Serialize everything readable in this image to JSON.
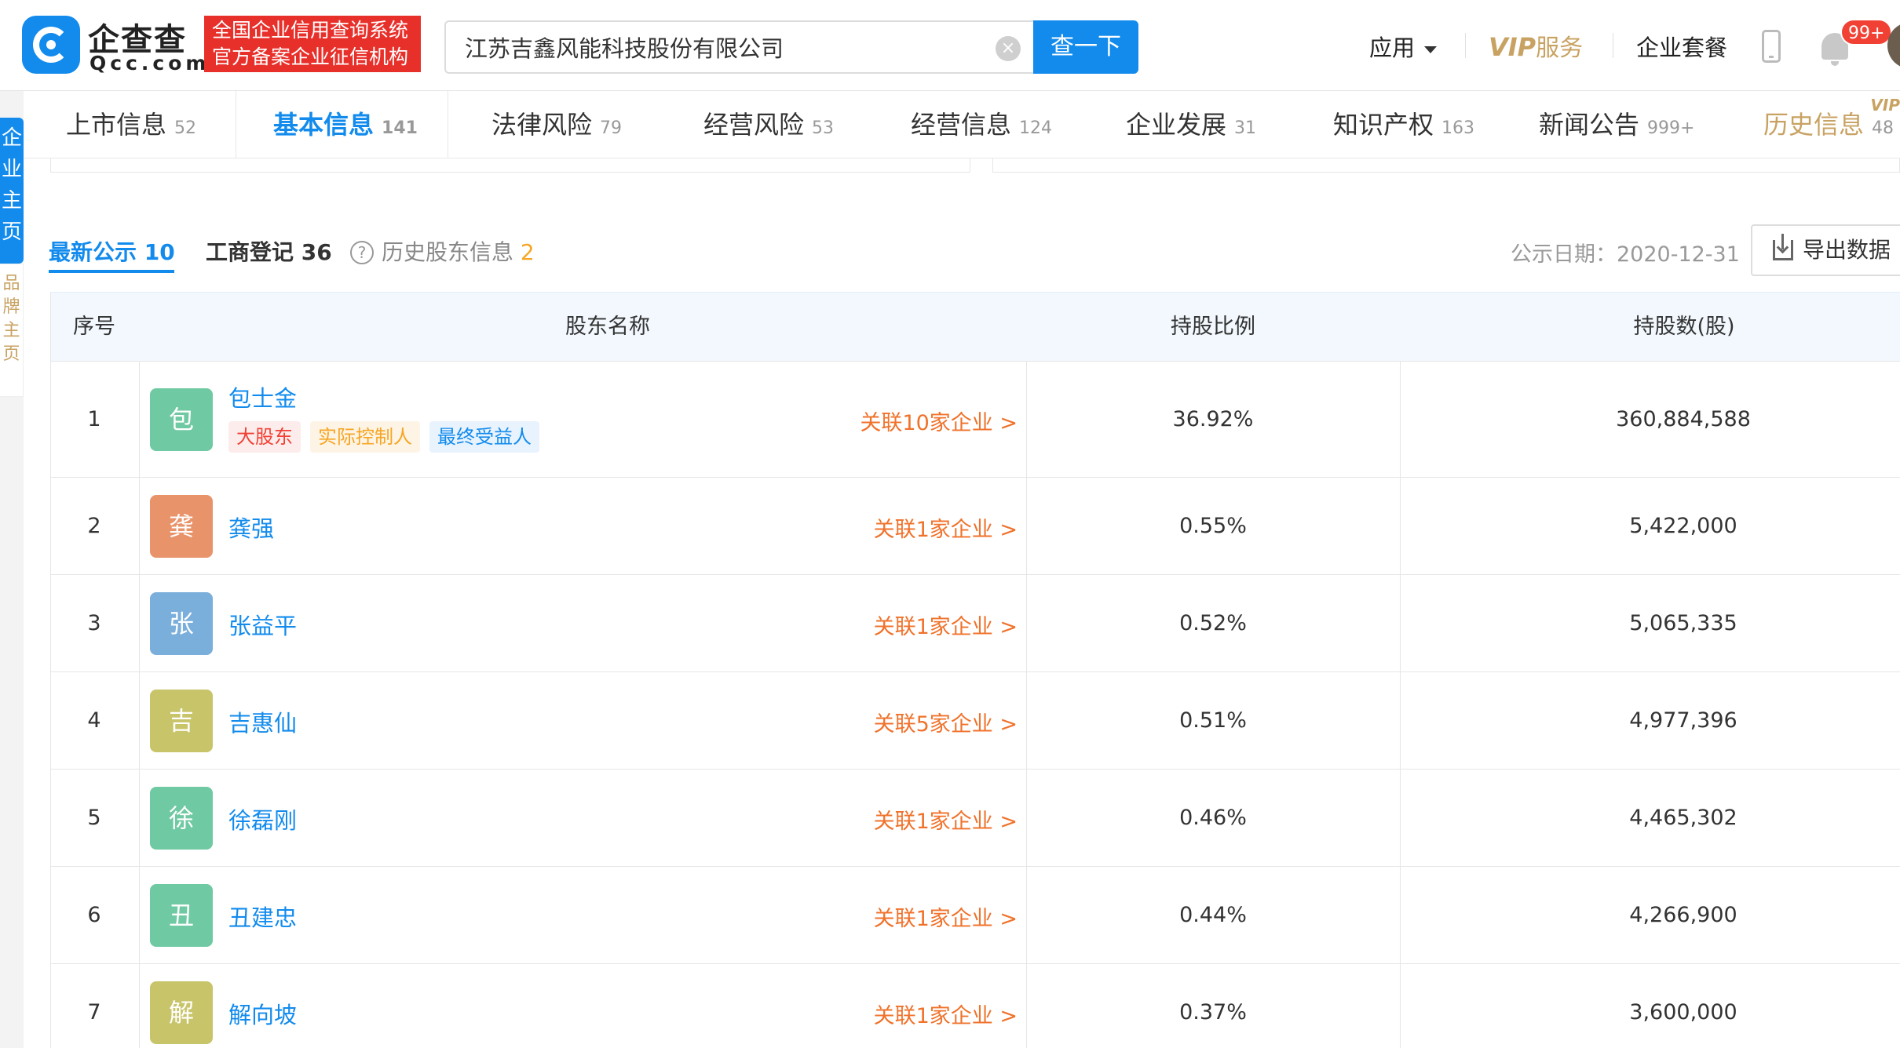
{
  "header": {
    "brand_name": "企查查",
    "brand_domain": "Qcc.com",
    "badge_line1": "全国企业信用查询系统",
    "badge_line2": "官方备案企业征信机构",
    "search_value": "江苏吉鑫风能科技股份有限公司",
    "search_button": "查一下",
    "nav_app": "应用",
    "nav_vip_letters": "VIP",
    "nav_vip_service": "服务",
    "nav_package": "企业套餐",
    "notif_count": "99+"
  },
  "side": {
    "tab_text": "企业主页",
    "brand_text": "品牌主页"
  },
  "tabs": [
    {
      "label": "上市信息",
      "count": "52"
    },
    {
      "label": "基本信息",
      "count": "141"
    },
    {
      "label": "法律风险",
      "count": "79"
    },
    {
      "label": "经营风险",
      "count": "53"
    },
    {
      "label": "经营信息",
      "count": "124"
    },
    {
      "label": "企业发展",
      "count": "31"
    },
    {
      "label": "知识产权",
      "count": "163"
    },
    {
      "label": "新闻公告",
      "count": "999+"
    },
    {
      "label": "历史信息",
      "count": "48"
    }
  ],
  "tabs_vip_mark": "VIP",
  "subtabs": {
    "latest_label": "最新公示",
    "latest_count": "10",
    "registry_label": "工商登记",
    "registry_count": "36",
    "history_label": "历史股东信息",
    "history_count": "2",
    "pub_date_label": "公示日期：",
    "pub_date_value": "2020-12-31",
    "export_label": "导出数据"
  },
  "table": {
    "headers": [
      "序号",
      "股东名称",
      "持股比例",
      "持股数(股)"
    ],
    "rows": [
      {
        "no": "1",
        "avatar": "包",
        "name": "包士金",
        "link": "关联10家企业 >",
        "ratio": "36.92%",
        "shares": "360,884,588",
        "tags": [
          "大股东",
          "实际控制人",
          "最终受益人"
        ]
      },
      {
        "no": "2",
        "avatar": "龚",
        "name": "龚强",
        "link": "关联1家企业 >",
        "ratio": "0.55%",
        "shares": "5,422,000"
      },
      {
        "no": "3",
        "avatar": "张",
        "name": "张益平",
        "link": "关联1家企业 >",
        "ratio": "0.52%",
        "shares": "5,065,335"
      },
      {
        "no": "4",
        "avatar": "吉",
        "name": "吉惠仙",
        "link": "关联5家企业 >",
        "ratio": "0.51%",
        "shares": "4,977,396"
      },
      {
        "no": "5",
        "avatar": "徐",
        "name": "徐磊刚",
        "link": "关联1家企业 >",
        "ratio": "0.46%",
        "shares": "4,465,302"
      },
      {
        "no": "6",
        "avatar": "丑",
        "name": "丑建忠",
        "link": "关联1家企业 >",
        "ratio": "0.44%",
        "shares": "4,266,900"
      },
      {
        "no": "7",
        "avatar": "解",
        "name": "解向坡",
        "link": "关联1家企业 >",
        "ratio": "0.37%",
        "shares": "3,600,000"
      }
    ]
  },
  "colors": {
    "accent": "#128bed",
    "link_orange": "#f0722b",
    "vip_gold": "#c8a262",
    "avatar_green": "#6fc9a2",
    "avatar_orange": "#e8936a",
    "avatar_blue": "#7aaedb",
    "avatar_olive": "#c8c46a"
  }
}
